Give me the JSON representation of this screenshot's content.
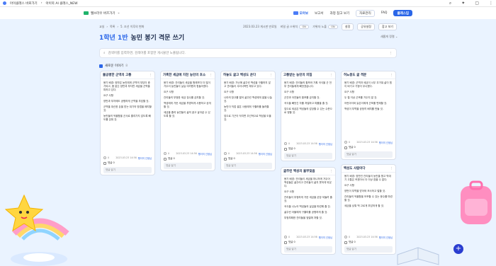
{
  "titlebar": {
    "crumbs": [
      "아이클래스 바로가기",
      "아이북 AI 클래스_NEW"
    ],
    "right_icons": [
      "search-icon",
      "puzzle-icon",
      "window-icon",
      "more-icon"
    ]
  },
  "appbar": {
    "brand_label": "웹브라우 버즈가기",
    "menu": [
      "모아보",
      "보고서",
      "과정 참고 보기",
      "자료관리",
      "FAQ",
      "클래스입"
    ],
    "active_index": 0
  },
  "controls": {
    "crumbs": [
      "교실",
      "목록",
      "5. 조선 이후의 변화"
    ],
    "status": "2023.03.23 게시판 만료일",
    "toggle1_label": "비밀 글 스위치",
    "toggle1_value": "ON",
    "toggle2_label": "가위자 노출",
    "toggle2_value": "ON",
    "btn_settings": "설정",
    "btn_share": "공유설정",
    "btn_print": "참고 보기"
  },
  "page": {
    "class_label": "1학년 1반",
    "title": "농민 봉기 격문 쓰기",
    "sort_label": "새롭게 정렬 ⌄"
  },
  "search": {
    "placeholder": "검색어를 입력하면, 검색어를 포함한 게시물만 노출됩니다."
  },
  "section": {
    "label": "새로운 이야기",
    "count": "8"
  },
  "cards": [
    {
      "title": "불공평한 군역의 고통",
      "lines": [
        "봉기 배경: 양반은 농민에게 군역의 부담이 증가되고, 몸 없는 양반과 부자만 세금을 군역을 피하고 있다.",
        "요구 사항",
        "양반과 부자에도 공평하게 군역을 부담할 것.",
        "군역을 대신한 돈을 받는 대기의 방법을 폐지할 것.",
        "농민들의 억울함을 군사로 줄여가지 않도록 빼도를 갖춰 것."
      ],
      "likes": "0",
      "date": "2023.03.23 14:56",
      "author": "팽이의 선생님",
      "comments": "댓글 0",
      "reply_placeholder": "댓글 달기"
    },
    {
      "title": "가혹한 세금에 지친 농민의 호소",
      "lines": [
        "봉기 배경: 관리들이 세금을 원래보다 더 많이 거두어 농민들이 살길 어려웠지 힘들어졌다.",
        "요구 사항",
        "관리들의 부정한 세금 징수를 금지할 것.",
        "백성에게 거둔 세금을 투명하게 사용하고 공개할 것.",
        "세금을 줄여 농민들이 삶의 꿈고 살아갈 수 있도록 할 것."
      ],
      "likes": "0",
      "date": "2023.03.23 14:56",
      "author": "팽이의 선생님",
      "comments": "댓글 0",
      "reply_placeholder": "댓글 달기"
    },
    {
      "title": "허놓도 굶고 백성도 운다",
      "lines": [
        "봉기 배경: 가난에 굶주린 백성을 구휼하지 않고 관리들이 사리사욕만 채우고 있다.",
        "요구 사항",
        "나라의 창고를 열어 굶주린 백성에게 쌀을 나눌 것.",
        "농민이 직접 쌀은 사람에게 구휼하를 돌려줄 것.",
        "앞으로 기근이 닥치면 우선적으로 백성을 도울 것."
      ],
      "likes": "0",
      "date": "2023.03.23 14:56",
      "author": "팽이의 선생님",
      "comments": "댓글 0",
      "reply_placeholder": "댓글 달기"
    },
    {
      "title": "고통받는 농민의 외침",
      "lines": [
        "봉기 배경: 관리들의 횡포와 가혹 국식을 군 전부 관리들에게 빼앗겼습니다.",
        "요구 사항",
        "군관과 아전들의 횡포를 금지할 것.",
        "곡식을 빼앗긴 자를 처벌하고 피를을 줄 것.",
        "앞으로 세금은 백성들의 감당할 수 있는 수준으로 정할 것."
      ],
      "likes": "0",
      "date": "2023.03.23 14:56",
      "author": "팽이의 선생님",
      "comments": "댓글 0",
      "reply_placeholder": "댓글 달기"
    },
    {
      "title": "허뇨몽도 굶 격문",
      "lines": [
        "봉기 배경: 군역과 세금이 너무 무거워 삶이 힘이 버기고 가정이 무너졌다.",
        "요구 사항",
        "두 철 이상 군포를 거두지 말 것.",
        "어린아이와 늙은이에게 군포를 면제할 것.",
        "백성이 부역을 공정히 배치를 만들 것."
      ],
      "likes": "0",
      "date": "2023.03.23 14:56",
      "author": "팽이의 선생님",
      "comments": "댓글 0",
      "reply_placeholder": "댓글 달기"
    },
    {
      "title": "굶주린 백성의 울부짖음",
      "lines": [
        "봉기 배경: 관리들이 세금을 마니하게 거두어 백성들은 굶주리고 관리들이 굶지 못하게 되었다.",
        "요구 사항",
        "관리들이 부정하게 거둔 세금을 곧장 되돌려 줄 것.",
        "곡식을 나누어 백성들의 살길을 마련해 줄 것.",
        "굶주린 아물에게 구휼미를 공평하게 줄 것.",
        "부정부패한 관리들을 엄벌에 처할 것."
      ],
      "likes": "0",
      "date": "2023.03.23 14:56",
      "author": "팽이의 선생님",
      "comments": "댓글 0",
      "reply_placeholder": "댓글 달기"
    },
    {
      "title": "백성도 사람이다",
      "lines": [
        "봉기 배경: 양반인 관리들이 농민을 함고 박대 기 고통은 커졌어서 더 이상 참을 수 없다.",
        "요구 사항",
        "양반이 부역을 받아와 조사하고 벌할 것.",
        "관리들의 억울함을 모조할 수 있는 응수를 마련할 것.",
        "세금을 낮춰 백 고르게 부담하게 할 것."
      ],
      "likes": "0",
      "date": "2023.03.23 14:56",
      "author": "팽이의 선생님",
      "comments": "댓글 0",
      "reply_placeholder": "댓글 달기"
    }
  ],
  "fab_label": "+",
  "colors": {
    "accent": "#2a66e8",
    "background": "#eaf3ff",
    "fab": "#2a3dd0"
  }
}
